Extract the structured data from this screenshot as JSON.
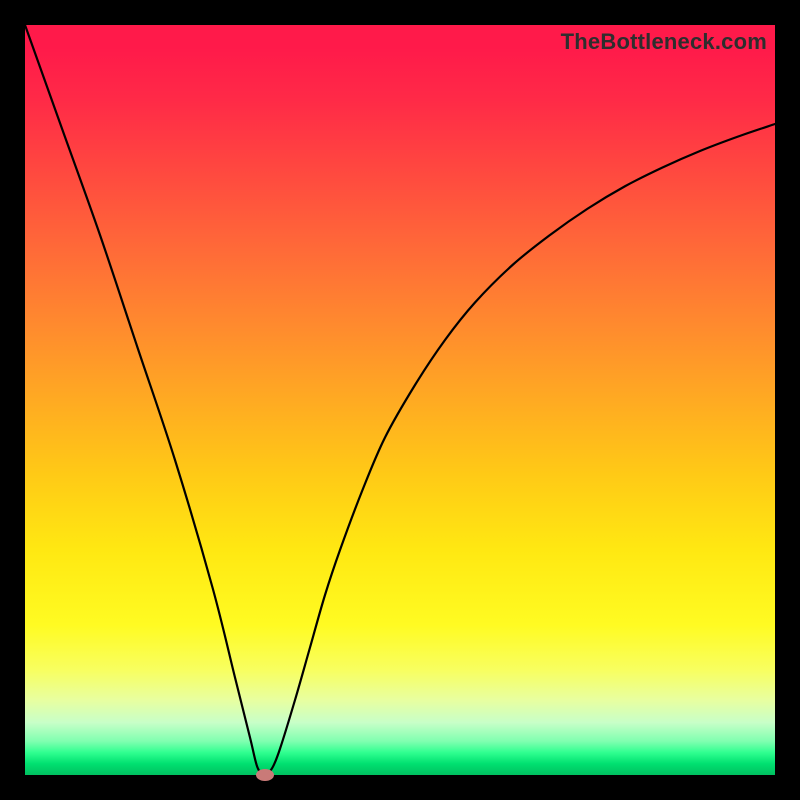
{
  "watermark": "TheBottleneck.com",
  "colors": {
    "frame": "#000000",
    "curve": "#000000",
    "marker": "#c97a78",
    "gradient_top": "#ff1a4a",
    "gradient_bottom": "#00c060"
  },
  "chart_data": {
    "type": "line",
    "title": "",
    "xlabel": "",
    "ylabel": "",
    "xlim": [
      0,
      100
    ],
    "ylim": [
      0,
      100
    ],
    "grid": false,
    "series": [
      {
        "name": "bottleneck-curve",
        "x": [
          0,
          5,
          10,
          15,
          20,
          25,
          28,
          30,
          31,
          32,
          33,
          34,
          36,
          38,
          40,
          42,
          45,
          48,
          52,
          56,
          60,
          65,
          70,
          75,
          80,
          85,
          90,
          95,
          100
        ],
        "values": [
          100,
          86,
          72,
          57,
          42,
          25,
          13,
          5,
          1,
          0,
          1,
          3.5,
          10,
          17,
          24,
          30,
          38,
          45,
          52,
          58,
          63,
          68,
          72,
          75.5,
          78.5,
          81,
          83.2,
          85.1,
          86.8
        ]
      }
    ],
    "marker": {
      "x": 32,
      "y": 0
    },
    "legend": false
  }
}
